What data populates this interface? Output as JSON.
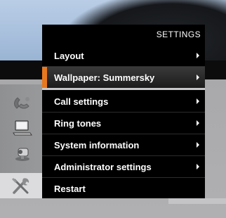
{
  "menu": {
    "header": "SETTINGS",
    "items": [
      {
        "label": "Layout",
        "has_submenu": true
      },
      {
        "label": "Wallpaper: Summersky",
        "has_submenu": true,
        "highlighted": true
      },
      {
        "label": "Call settings",
        "has_submenu": true
      },
      {
        "label": "Ring tones",
        "has_submenu": true
      },
      {
        "label": "System information",
        "has_submenu": true
      },
      {
        "label": "Administrator settings",
        "has_submenu": true
      },
      {
        "label": "Restart",
        "has_submenu": false
      }
    ]
  },
  "sidebar": {
    "icons": [
      "phone-handset-icon",
      "laptop-icon",
      "camera-icon",
      "tools-icon"
    ],
    "selected": "tools-icon"
  },
  "colors": {
    "accent": "#e8781e",
    "menu_bg": "#000000",
    "text": "#ffffff"
  }
}
